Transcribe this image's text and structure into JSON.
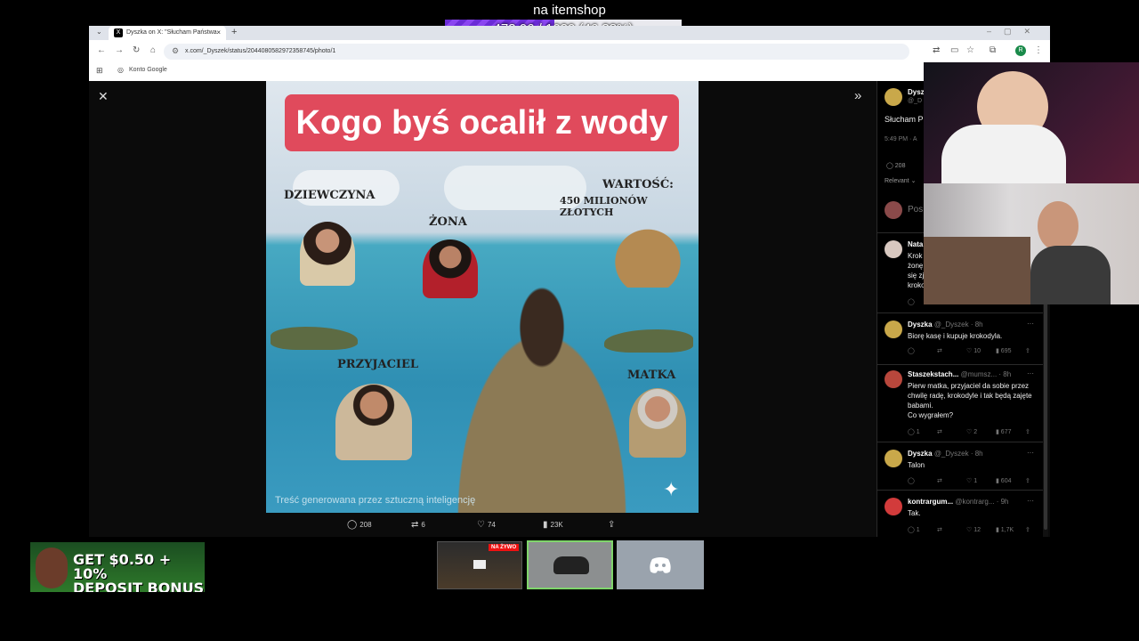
{
  "overlay": {
    "title": "na itemshop",
    "progress_text": "473.06 / 1020 (46.38%)",
    "progress_fraction": 0.4638,
    "fill_color": "#7a38e6"
  },
  "browser": {
    "tab_title": "Dyszka on X: \"Słucham Państwa",
    "tab_close": "×",
    "new_tab": "+",
    "url": "x.com/_Dyszek/status/2044080582972358745/photo/1",
    "bookmark": "Konto Google",
    "profile_initial": "R"
  },
  "image": {
    "title": "Kogo byś ocalił z wody",
    "label_girlfriend": "DZIEWCZYNA",
    "label_wife": "ŻONA",
    "label_worth": "WARTOŚĆ:",
    "label_worth_amount": "450 MILIONÓW ZŁOTYCH",
    "label_friend": "PRZYJACIEL",
    "label_mother": "MATKA",
    "ai_note": "Treść generowana przez sztuczną inteligencję"
  },
  "actions": {
    "replies": "208",
    "reposts": "6",
    "likes": "74",
    "views": "23K"
  },
  "right": {
    "op_name": "Dysz",
    "op_handle": "@_D",
    "op_text": "Słucham P",
    "op_time": "5:49 PM · A",
    "op_replies": "208",
    "sort": "Relevant",
    "post_placeholder": "Pos",
    "tweets": [
      {
        "name": "Nata",
        "text": "Krok\nżonę\nsię zj\nkroko",
        "replies": "",
        "reposts": "",
        "likes": "",
        "views": ""
      },
      {
        "name": "Dyszka",
        "handle": "@_Dyszek · 8h",
        "text": "Biorę kasę i kupuje krokodyla.",
        "replies": "",
        "reposts": "",
        "likes": "10",
        "views": "695"
      },
      {
        "name": "Staszekstach...",
        "handle": "@mumsz... · 8h",
        "text": "Pierw matka, przyjaciel da sobie przez chwilę radę, krokodyle i tak będą zajęte babami.\nCo wygrałem?",
        "replies": "1",
        "reposts": "",
        "likes": "2",
        "views": "677"
      },
      {
        "name": "Dyszka",
        "handle": "@_Dyszek · 8h",
        "text": "Talon",
        "replies": "",
        "reposts": "",
        "likes": "1",
        "views": "604"
      },
      {
        "name": "kontrargum...",
        "handle": "@kontrarg... · 9h",
        "text": "Tak.",
        "replies": "1",
        "reposts": "",
        "likes": "12",
        "views": "1,7K"
      }
    ]
  },
  "promo": {
    "line1": "GET $0.50 + 10%",
    "line2": "DEPOSIT BONUS"
  },
  "thumbs": {
    "live_badge": "NA ŻYWO"
  }
}
